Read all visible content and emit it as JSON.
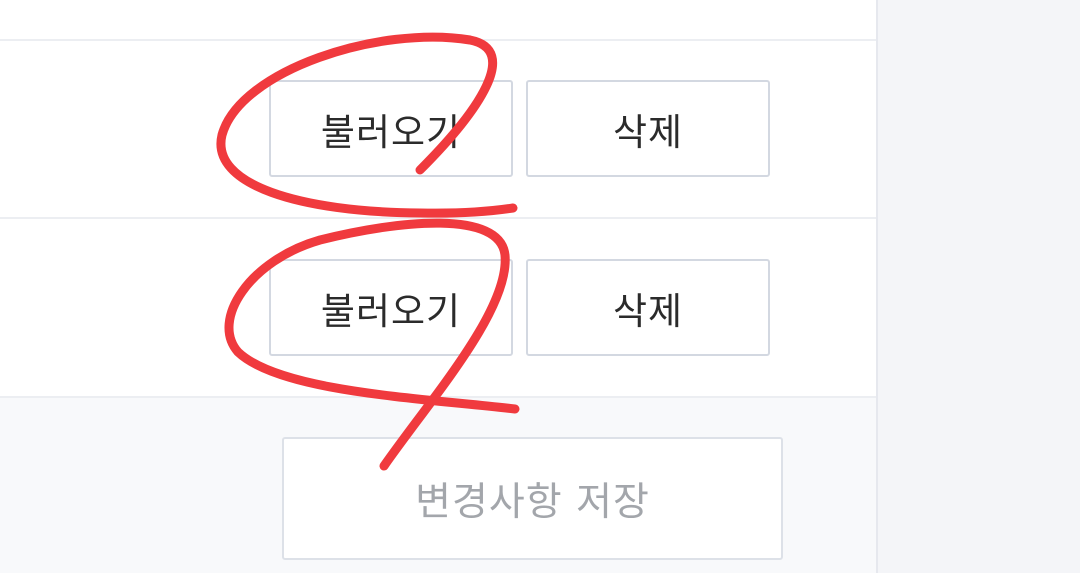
{
  "rows": [
    {
      "load_label": "불러오기",
      "delete_label": "삭제"
    },
    {
      "load_label": "불러오기",
      "delete_label": "삭제"
    }
  ],
  "footer": {
    "save_label": "변경사항 저장"
  },
  "annotation_color": "#f03a3e"
}
